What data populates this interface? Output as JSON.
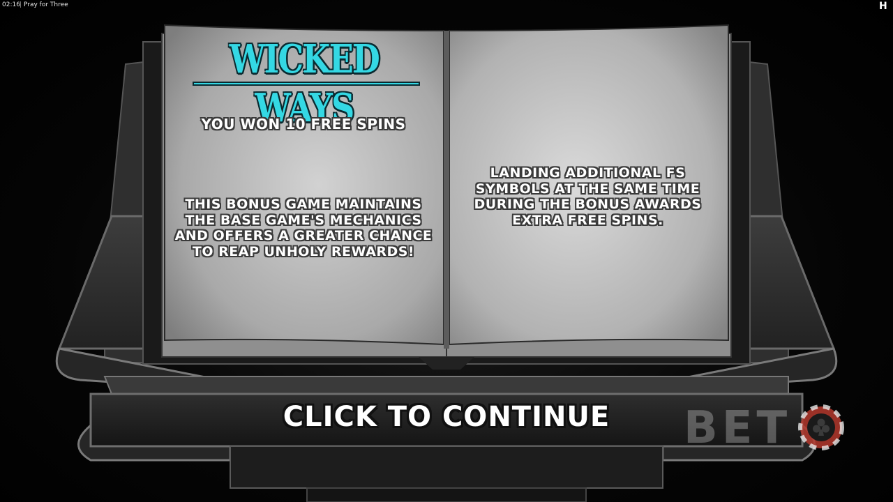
{
  "status_bar": {
    "time": "02:16",
    "separator": "|",
    "game_title": "Pray for Three",
    "brand_glyph": "H"
  },
  "book": {
    "logo_text": "WICKED WAYS",
    "left_page": {
      "headline": "YOU WON 10 FREE SPINS",
      "body": "THIS BONUS GAME MAINTAINS THE BASE GAME'S MECHANICS AND OFFERS A GREATER CHANCE TO REAP UNHOLY REWARDS!"
    },
    "right_page": {
      "body": "LANDING ADDITIONAL FS SYMBOLS AT THE SAME TIME DURING THE BONUS AWARDS EXTRA FREE SPINS."
    }
  },
  "continue_label": "CLICK TO CONTINUE",
  "watermark": {
    "text": "BET",
    "icon": "poker-chip-club-icon"
  },
  "colors": {
    "logo_cyan": "#34d8e4",
    "chip_red": "#c0392b",
    "page_grey": "#b9b9b9"
  }
}
